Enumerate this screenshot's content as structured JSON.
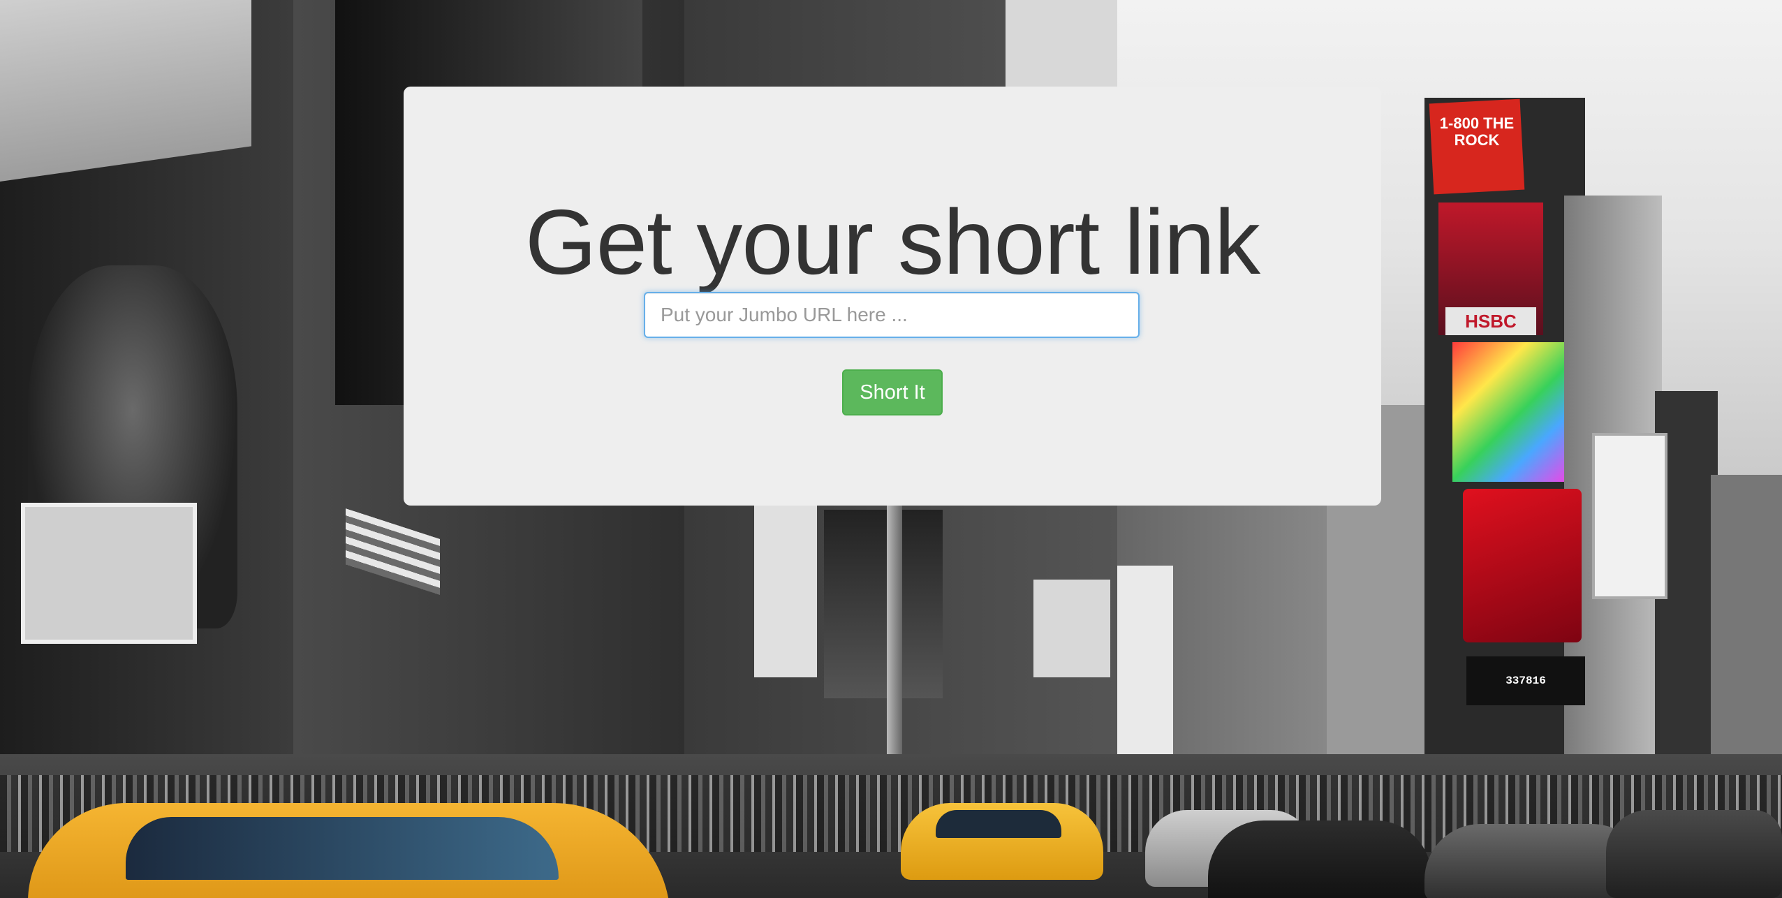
{
  "hero": {
    "title": "Get your short link",
    "input_placeholder": "Put your Jumbo URL here ...",
    "input_value": "",
    "button_label": "Short It"
  },
  "background": {
    "description_icons": [
      "city-background"
    ],
    "billboard_texts": {
      "rock": "1-800 THE ROCK",
      "hsbc": "HSBC",
      "ticker": "337816"
    }
  },
  "colors": {
    "card_bg": "#eeeeee",
    "title": "#333333",
    "button_bg": "#5cb85c",
    "input_focus_border": "#66afe9"
  }
}
